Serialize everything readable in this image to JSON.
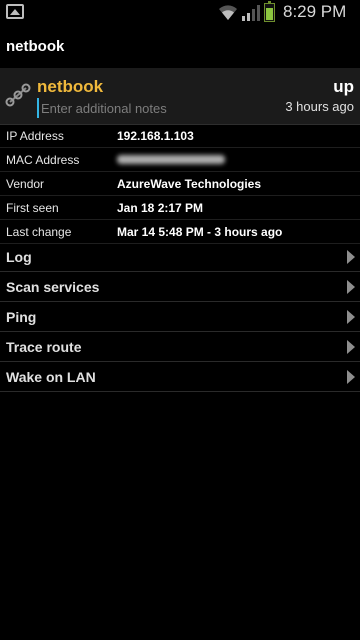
{
  "status_bar": {
    "time": "8:29 PM",
    "icons": [
      "gallery-icon",
      "wifi-icon",
      "signal-icon",
      "battery-icon"
    ],
    "battery_color": "#8cc63f"
  },
  "titlebar": {
    "title": "netbook"
  },
  "device": {
    "name": "netbook",
    "name_color": "#f0b93c",
    "notes_placeholder": "Enter additional notes",
    "status": "up",
    "last_change_ago": "3 hours ago",
    "icon": "network-nodes-icon"
  },
  "info": [
    {
      "label": "IP Address",
      "value": "192.168.1.103"
    },
    {
      "label": "MAC Address",
      "value": ""
    },
    {
      "label": "Vendor",
      "value": "AzureWave Technologies"
    },
    {
      "label": "First seen",
      "value": "Jan 18 2:17 PM"
    },
    {
      "label": "Last change",
      "value": "Mar 14 5:48 PM - 3 hours ago"
    }
  ],
  "actions": [
    {
      "label": "Log"
    },
    {
      "label": "Scan services"
    },
    {
      "label": "Ping"
    },
    {
      "label": "Trace route"
    },
    {
      "label": "Wake on LAN"
    }
  ]
}
